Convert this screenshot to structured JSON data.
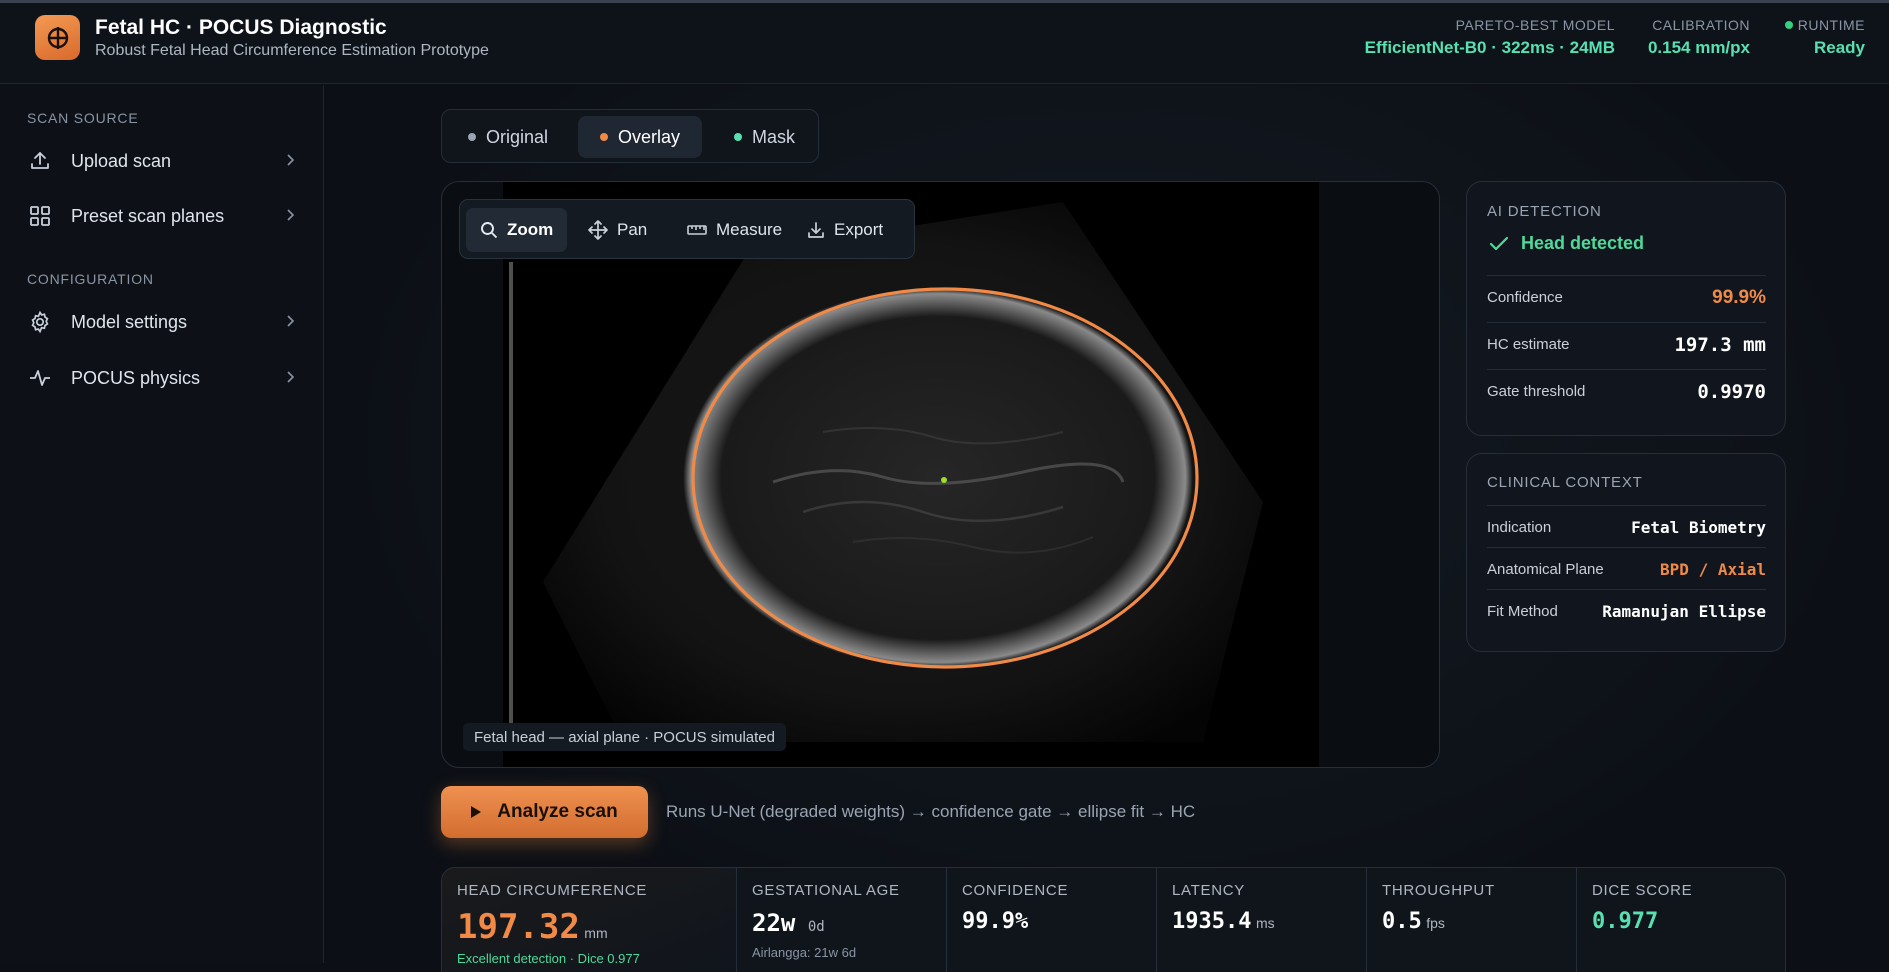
{
  "header": {
    "title": "Fetal HC · POCUS Diagnostic",
    "subtitle": "Robust Fetal Head Circumference Estimation Prototype",
    "logo_icon": "crosshair-icon",
    "stats": [
      {
        "label": "PARETO-BEST MODEL",
        "value": "EfficientNet-B0 · 322ms · 24MB"
      },
      {
        "label": "CALIBRATION",
        "value": "0.154 mm/px"
      },
      {
        "label": "RUNTIME",
        "value": "Ready"
      }
    ]
  },
  "sidebar": {
    "sections": [
      {
        "label": "SCAN SOURCE",
        "items": [
          {
            "label": "Upload scan",
            "icon": "upload-icon"
          },
          {
            "label": "Preset scan planes",
            "icon": "grid-icon"
          }
        ]
      },
      {
        "label": "CONFIGURATION",
        "items": [
          {
            "label": "Model settings",
            "icon": "gear-icon"
          },
          {
            "label": "POCUS physics",
            "icon": "pulse-icon"
          }
        ]
      }
    ]
  },
  "view_toggle": {
    "options": [
      {
        "label": "Original",
        "dot_color": "#9aa4b2"
      },
      {
        "label": "Overlay",
        "dot_color": "#f08a46",
        "active": true
      },
      {
        "label": "Mask",
        "dot_color": "#58e0b0"
      }
    ]
  },
  "viewer": {
    "tools": [
      {
        "label": "Zoom",
        "icon": "search-icon",
        "active": true
      },
      {
        "label": "Pan",
        "icon": "move-icon"
      },
      {
        "label": "Measure",
        "icon": "ruler-icon"
      },
      {
        "label": "Export",
        "icon": "download-icon"
      }
    ],
    "caption": "Fetal head — axial plane · POCUS simulated",
    "overlay_color": "#f08a46",
    "center_color": "#9be02a"
  },
  "ai_detection": {
    "title": "AI DETECTION",
    "status": "Head detected",
    "rows": [
      {
        "key": "Confidence",
        "value": "99.9%"
      },
      {
        "key": "HC estimate",
        "value": "197.3 mm"
      },
      {
        "key": "Gate threshold",
        "value": "0.9970"
      }
    ]
  },
  "clinical_context": {
    "title": "CLINICAL CONTEXT",
    "rows": [
      {
        "key": "Indication",
        "value": "Fetal Biometry"
      },
      {
        "key": "Anatomical Plane",
        "value": "BPD / Axial"
      },
      {
        "key": "Fit Method",
        "value": "Ramanujan Ellipse"
      }
    ]
  },
  "actions": {
    "analyze_label": "Analyze scan",
    "pipeline": "Runs U-Net (degraded weights) → confidence gate → ellipse fit → HC"
  },
  "metrics": [
    {
      "label": "HEAD CIRCUMFERENCE",
      "value": "197.32",
      "unit": "mm",
      "sub": "Excellent detection · Dice 0.977"
    },
    {
      "label": "GESTATIONAL AGE",
      "value": "22w",
      "unit": "0d",
      "sub": "Airlangga: 21w 6d"
    },
    {
      "label": "CONFIDENCE",
      "value": "99.9%"
    },
    {
      "label": "LATENCY",
      "value": "1935.4",
      "unit": "ms"
    },
    {
      "label": "THROUGHPUT",
      "value": "0.5",
      "unit": "fps"
    },
    {
      "label": "DICE SCORE",
      "value": "0.977"
    }
  ],
  "colors": {
    "accent_orange": "#f08a46",
    "accent_green": "#58e0b0",
    "status_green": "#32d07f",
    "background": "#0c1016"
  }
}
